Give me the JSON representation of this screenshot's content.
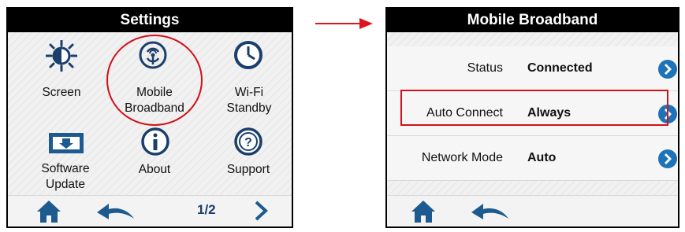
{
  "left_screen": {
    "title": "Settings",
    "items": [
      {
        "label": "Screen",
        "icon": "brightness-icon"
      },
      {
        "label": "Mobile Broadband",
        "icon": "mobile-broadband-icon"
      },
      {
        "label": "Wi-Fi Standby",
        "icon": "clock-icon"
      },
      {
        "label": "Software Update",
        "icon": "download-icon"
      },
      {
        "label": "About",
        "icon": "info-icon"
      },
      {
        "label": "Support",
        "icon": "help-icon"
      }
    ],
    "pager": "1/2"
  },
  "right_screen": {
    "title": "Mobile Broadband",
    "rows": [
      {
        "label": "Status",
        "value": "Connected"
      },
      {
        "label": "Auto Connect",
        "value": "Always"
      },
      {
        "label": "Network Mode",
        "value": "Auto"
      }
    ]
  },
  "colors": {
    "accent_blue": "#1d72b8",
    "highlight_red": "#d0111b",
    "titlebar": "#000000"
  }
}
